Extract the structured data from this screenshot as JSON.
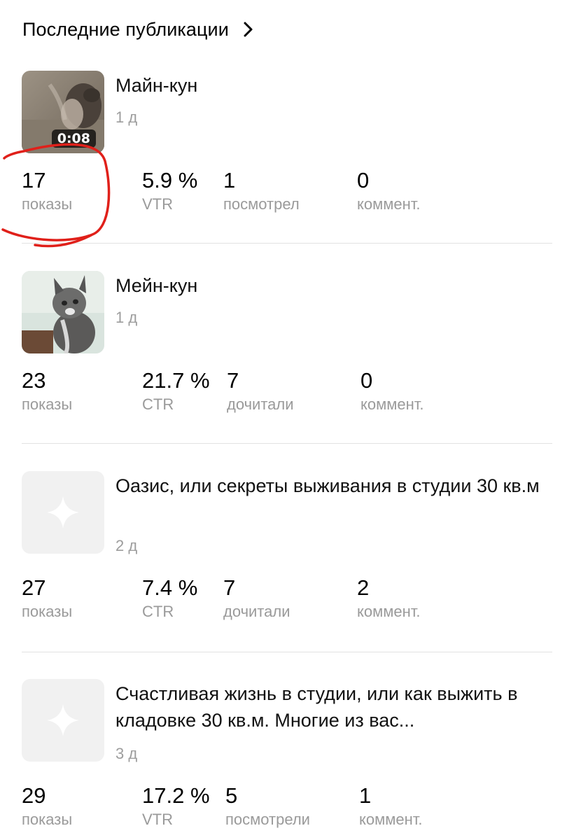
{
  "header": {
    "title": "Последние публикации"
  },
  "posts": [
    {
      "title": "Майн-кун",
      "age": "1 д",
      "duration": "0:08",
      "stats": [
        {
          "value": "17",
          "label": "показы"
        },
        {
          "value": "5.9 %",
          "label": "VTR"
        },
        {
          "value": "1",
          "label": "посмотрел"
        },
        {
          "value": "0",
          "label": "коммент."
        }
      ]
    },
    {
      "title": "Мейн-кун",
      "age": "1 д",
      "stats": [
        {
          "value": "23",
          "label": "показы"
        },
        {
          "value": "21.7 %",
          "label": "CTR"
        },
        {
          "value": "7",
          "label": "дочитали"
        },
        {
          "value": "0",
          "label": "коммент."
        }
      ]
    },
    {
      "title": "Оазис, или секреты выживания в студии 30 кв.м",
      "age": "2 д",
      "stats": [
        {
          "value": "27",
          "label": "показы"
        },
        {
          "value": "7.4 %",
          "label": "CTR"
        },
        {
          "value": "7",
          "label": "дочитали"
        },
        {
          "value": "2",
          "label": "коммент."
        }
      ]
    },
    {
      "title": "Счастливая жизнь в студии, или как выжить в кладовке 30 кв.м. Многие из вас...",
      "age": "3 д",
      "stats": [
        {
          "value": "29",
          "label": "показы"
        },
        {
          "value": "17.2 %",
          "label": "VTR"
        },
        {
          "value": "5",
          "label": "посмотрели"
        },
        {
          "value": "1",
          "label": "коммент."
        }
      ]
    }
  ],
  "colors": {
    "muted_text": "#9a9a9a",
    "divider": "#e2e2e2",
    "annotation": "#e0201a",
    "placeholder": "#f1f1f1"
  },
  "icons": {
    "header": "chevron-right-icon",
    "placeholder": "sparkle-icon",
    "annotation": "hand-drawn-circle"
  }
}
